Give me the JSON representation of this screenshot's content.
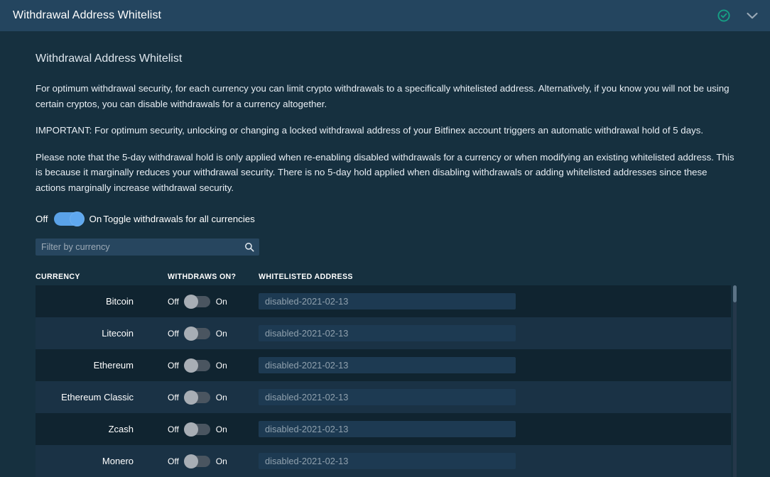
{
  "titlebar": {
    "title": "Withdrawal Address Whitelist",
    "status_icon": "check-circle-icon",
    "collapse_icon": "chevron-down-icon"
  },
  "colors": {
    "titlebar_bg": "#24455f",
    "page_bg": "#16303f",
    "accent_blue": "#5aa2e8",
    "status_green": "#16a085",
    "row_odd": "#102430",
    "row_even": "#1a3245"
  },
  "main": {
    "section_title": "Withdrawal Address Whitelist",
    "paragraphs": [
      "For optimum withdrawal security, for each currency you can limit crypto withdrawals to a specifically whitelisted address. Alternatively, if you know you will not be using certain cryptos, you can disable withdrawals for a currency altogether.",
      "IMPORTANT: For optimum security, unlocking or changing a locked withdrawal address of your Bitfinex account triggers an automatic withdrawal hold of 5 days.",
      "Please note that the 5-day withdrawal hold is only applied when re-enabling disabled withdrawals for a currency or when modifying an existing whitelisted address. This is because it marginally reduces your withdrawal security. There is no 5-day hold applied when disabling withdrawals or adding whitelisted addresses since these actions marginally increase withdrawal security."
    ]
  },
  "master_toggle": {
    "off_label": "Off",
    "on_label": "On",
    "caption": "Toggle withdrawals for all currencies",
    "state": "on"
  },
  "filter": {
    "placeholder": "Filter by currency",
    "value": "",
    "icon": "search-icon"
  },
  "table": {
    "headers": {
      "currency": "CURRENCY",
      "withdraws_on": "WITHDRAWS ON?",
      "whitelisted_address": "WHITELISTED ADDRESS"
    },
    "toggle_off_label": "Off",
    "toggle_on_label": "On",
    "rows": [
      {
        "currency": "Bitcoin",
        "withdraws_on": "off",
        "address_placeholder": "disabled-2021-02-13",
        "address_value": ""
      },
      {
        "currency": "Litecoin",
        "withdraws_on": "off",
        "address_placeholder": "disabled-2021-02-13",
        "address_value": ""
      },
      {
        "currency": "Ethereum",
        "withdraws_on": "off",
        "address_placeholder": "disabled-2021-02-13",
        "address_value": ""
      },
      {
        "currency": "Ethereum Classic",
        "withdraws_on": "off",
        "address_placeholder": "disabled-2021-02-13",
        "address_value": ""
      },
      {
        "currency": "Zcash",
        "withdraws_on": "off",
        "address_placeholder": "disabled-2021-02-13",
        "address_value": ""
      },
      {
        "currency": "Monero",
        "withdraws_on": "off",
        "address_placeholder": "disabled-2021-02-13",
        "address_value": ""
      }
    ]
  }
}
